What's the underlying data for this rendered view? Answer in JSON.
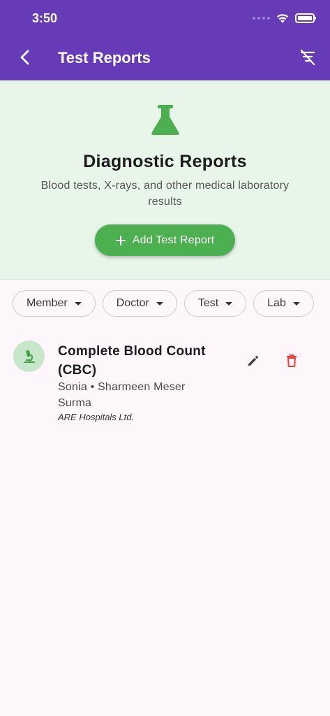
{
  "colors": {
    "app_bar": "#673AB7",
    "hero_bg": "#E8F5E9",
    "accent_green": "#4CAF50",
    "avatar_bg": "#C8E6C9",
    "delete_red": "#F44336",
    "page_bg": "#FDF7FB"
  },
  "status_bar": {
    "time": "3:50",
    "icons": [
      "cellular-signal-icon",
      "wifi-icon",
      "battery-icon"
    ]
  },
  "app_bar": {
    "title": "Test Reports",
    "back_icon": "chevron-left-icon",
    "filter_icon": "filter-off-icon"
  },
  "hero": {
    "icon": "flask-icon",
    "title": "Diagnostic Reports",
    "subtitle": "Blood tests, X-rays, and other medical laboratory results",
    "add_button": {
      "icon": "plus-icon",
      "label": "Add Test Report"
    }
  },
  "filters": {
    "chips": [
      {
        "label": "Member"
      },
      {
        "label": "Doctor"
      },
      {
        "label": "Test"
      },
      {
        "label": "Lab"
      }
    ]
  },
  "reports": [
    {
      "icon": "microscope-icon",
      "title": "Complete Blood Count (CBC)",
      "subtitle": "Sonia • Sharmeen Meser Surma",
      "lab": "ARE Hospitals Ltd.",
      "actions": [
        "edit-icon",
        "delete-icon"
      ]
    }
  ]
}
